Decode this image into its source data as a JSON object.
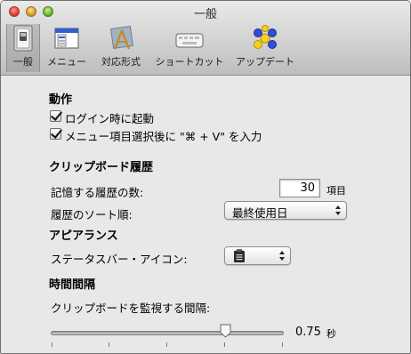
{
  "window": {
    "title": "一般"
  },
  "toolbar": {
    "items": [
      {
        "label": "一般",
        "icon": "general-switch-icon",
        "selected": true
      },
      {
        "label": "メニュー",
        "icon": "menu-window-icon",
        "selected": false
      },
      {
        "label": "対応形式",
        "icon": "formats-app-icon",
        "selected": false
      },
      {
        "label": "ショートカット",
        "icon": "keyboard-icon",
        "selected": false
      },
      {
        "label": "アップデート",
        "icon": "update-molecule-icon",
        "selected": false
      }
    ]
  },
  "behavior": {
    "title": "動作",
    "login_label": "ログイン時に起動",
    "login_checked": true,
    "menu_label": "メニュー項目選択後に \"⌘ + V\" を入力",
    "menu_checked": true
  },
  "history": {
    "title": "クリップボード履歴",
    "count_label": "記憶する履歴の数:",
    "count_value": "30",
    "count_unit": "項目",
    "sort_label": "履歴のソート順:",
    "sort_value": "最終使用日"
  },
  "appearance": {
    "title": "アピアランス",
    "statusbar_label": "ステータスバー・アイコン:",
    "statusbar_icon": "clipboard-icon"
  },
  "interval": {
    "title": "時間間隔",
    "label": "クリップボードを監視する間隔:",
    "value": "0.75",
    "unit": "秒",
    "slider_fraction": 0.75
  },
  "colors": {
    "accent": "#2f5fd0",
    "window_bg": "#e8e8e8"
  }
}
